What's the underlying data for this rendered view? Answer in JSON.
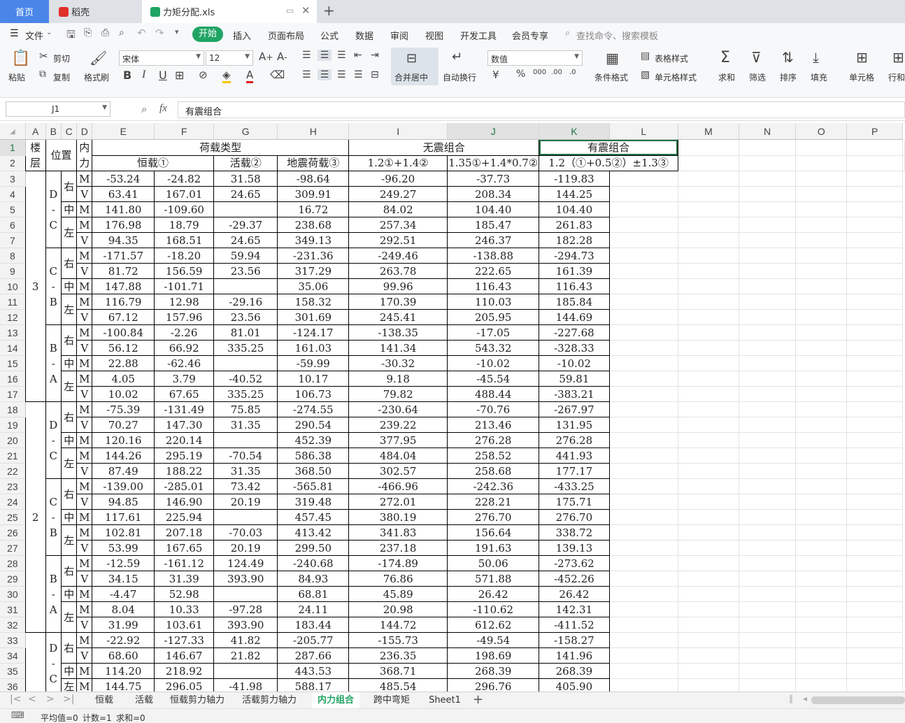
{
  "tabs": {
    "home": "首页",
    "daoke": "稻壳",
    "file": "力矩分配.xls"
  },
  "menu": {
    "file": "文件",
    "items": [
      "开始",
      "插入",
      "页面布局",
      "公式",
      "数据",
      "审阅",
      "视图",
      "开发工具",
      "会员专享"
    ],
    "search": "查找命令、搜索模板"
  },
  "ribbon": {
    "paste": "粘贴",
    "cut": "剪切",
    "copy": "复制",
    "format_painter": "格式刷",
    "font": "宋体",
    "size": "12",
    "merge": "合并居中",
    "wrap": "自动换行",
    "numfmt": "数值",
    "cond": "条件格式",
    "table_style": "表格样式",
    "cell_style": "单元格样式",
    "sum": "求和",
    "filter": "筛选",
    "sort": "排序",
    "fill": "填充",
    "cell": "单元格",
    "rowcol": "行和"
  },
  "formula": {
    "cellref": "J1",
    "fx": "fx",
    "value": "有震组合"
  },
  "grid": {
    "col_headers": [
      "A",
      "B",
      "C",
      "D",
      "E",
      "F",
      "G",
      "H",
      "I",
      "J",
      "K",
      "L",
      "M",
      "N",
      "O",
      "P"
    ],
    "row_numbers": [
      "1",
      "2",
      "3",
      "4",
      "5",
      "6",
      "7",
      "8",
      "9",
      "10",
      "11",
      "12",
      "13",
      "14",
      "15",
      "16",
      "17",
      "18",
      "19",
      "20",
      "21",
      "22",
      "23",
      "24",
      "25",
      "26",
      "27",
      "28",
      "29",
      "30",
      "31",
      "32",
      "33",
      "34",
      "35",
      "36"
    ],
    "head1": {
      "a": "楼层",
      "b": "位置",
      "d": "内力",
      "load": "荷载类型",
      "nonseis": "无震组合",
      "seis": "有震组合"
    },
    "head2": {
      "e": "恒载①",
      "f": "活载②",
      "g": "地震荷载③",
      "h": "1.2①+1.4②",
      "i": "1.35①+1.4*0.7②",
      "jk": "1.2（①+0.5②）±1.3③"
    },
    "floors": [
      "3",
      "2"
    ],
    "spans": [
      "D",
      "-",
      "C",
      "C",
      "-",
      "B",
      "B",
      "-",
      "A"
    ],
    "pos": [
      "右",
      "中",
      "左"
    ],
    "rows": [
      [
        "M",
        "-53.24",
        "-24.82",
        "31.58",
        "-98.64",
        "-96.20",
        "-37.73",
        "-119.83"
      ],
      [
        "V",
        "63.41",
        "167.01",
        "24.65",
        "309.91",
        "249.27",
        "208.34",
        "144.25"
      ],
      [
        "M",
        "141.80",
        "-109.60",
        "",
        "16.72",
        "84.02",
        "104.40",
        "104.40"
      ],
      [
        "M",
        "176.98",
        "18.79",
        "-29.37",
        "238.68",
        "257.34",
        "185.47",
        "261.83"
      ],
      [
        "V",
        "94.35",
        "168.51",
        "24.65",
        "349.13",
        "292.51",
        "246.37",
        "182.28"
      ],
      [
        "M",
        "-171.57",
        "-18.20",
        "59.94",
        "-231.36",
        "-249.46",
        "-138.88",
        "-294.73"
      ],
      [
        "V",
        "81.72",
        "156.59",
        "23.56",
        "317.29",
        "263.78",
        "222.65",
        "161.39"
      ],
      [
        "M",
        "147.88",
        "-101.71",
        "",
        "35.06",
        "99.96",
        "116.43",
        "116.43"
      ],
      [
        "M",
        "116.79",
        "12.98",
        "-29.16",
        "158.32",
        "170.39",
        "110.03",
        "185.84"
      ],
      [
        "V",
        "67.12",
        "157.96",
        "23.56",
        "301.69",
        "245.41",
        "205.95",
        "144.69"
      ],
      [
        "M",
        "-100.84",
        "-2.26",
        "81.01",
        "-124.17",
        "-138.35",
        "-17.05",
        "-227.68"
      ],
      [
        "V",
        "56.12",
        "66.92",
        "335.25",
        "161.03",
        "141.34",
        "543.32",
        "-328.33"
      ],
      [
        "M",
        "22.88",
        "-62.46",
        "",
        "-59.99",
        "-30.32",
        "-10.02",
        "-10.02"
      ],
      [
        "M",
        "4.05",
        "3.79",
        "-40.52",
        "10.17",
        "9.18",
        "-45.54",
        "59.81"
      ],
      [
        "V",
        "10.02",
        "67.65",
        "335.25",
        "106.73",
        "79.82",
        "488.44",
        "-383.21"
      ],
      [
        "M",
        "-75.39",
        "-131.49",
        "75.85",
        "-274.55",
        "-230.64",
        "-70.76",
        "-267.97"
      ],
      [
        "V",
        "70.27",
        "147.30",
        "31.35",
        "290.54",
        "239.22",
        "213.46",
        "131.95"
      ],
      [
        "M",
        "120.16",
        "220.14",
        "",
        "452.39",
        "377.95",
        "276.28",
        "276.28"
      ],
      [
        "M",
        "144.26",
        "295.19",
        "-70.54",
        "586.38",
        "484.04",
        "258.52",
        "441.93"
      ],
      [
        "V",
        "87.49",
        "188.22",
        "31.35",
        "368.50",
        "302.57",
        "258.68",
        "177.17"
      ],
      [
        "M",
        "-139.00",
        "-285.01",
        "73.42",
        "-565.81",
        "-466.96",
        "-242.36",
        "-433.25"
      ],
      [
        "V",
        "94.85",
        "146.90",
        "20.19",
        "319.48",
        "272.01",
        "228.21",
        "175.71"
      ],
      [
        "M",
        "117.61",
        "225.94",
        "",
        "457.45",
        "380.19",
        "276.70",
        "276.70"
      ],
      [
        "M",
        "102.81",
        "207.18",
        "-70.03",
        "413.42",
        "341.83",
        "156.64",
        "338.72"
      ],
      [
        "V",
        "53.99",
        "167.65",
        "20.19",
        "299.50",
        "237.18",
        "191.63",
        "139.13"
      ],
      [
        "M",
        "-12.59",
        "-161.12",
        "124.49",
        "-240.68",
        "-174.89",
        "50.06",
        "-273.62"
      ],
      [
        "V",
        "34.15",
        "31.39",
        "393.90",
        "84.93",
        "76.86",
        "571.88",
        "-452.26"
      ],
      [
        "M",
        "-4.47",
        "52.98",
        "",
        "68.81",
        "45.89",
        "26.42",
        "26.42"
      ],
      [
        "M",
        "8.04",
        "10.33",
        "-97.28",
        "24.11",
        "20.98",
        "-110.62",
        "142.31"
      ],
      [
        "V",
        "31.99",
        "103.61",
        "393.90",
        "183.44",
        "144.72",
        "612.62",
        "-411.52"
      ],
      [
        "M",
        "-22.92",
        "-127.33",
        "41.82",
        "-205.77",
        "-155.73",
        "-49.54",
        "-158.27"
      ],
      [
        "V",
        "68.60",
        "146.67",
        "21.82",
        "287.66",
        "236.35",
        "198.69",
        "141.96"
      ],
      [
        "M",
        "114.20",
        "218.92",
        "",
        "443.53",
        "368.71",
        "268.39",
        "268.39"
      ],
      [
        "M",
        "144.75",
        "296.05",
        "-41.98",
        "588.17",
        "485.54",
        "296.76",
        "405.90"
      ]
    ]
  },
  "sheets": {
    "items": [
      "恒载",
      "活载",
      "恒载剪力轴力",
      "活载剪力轴力",
      "内力组合",
      "跨中弯矩",
      "Sheet1"
    ],
    "active": 4
  },
  "status": {
    "avg": "平均值=0",
    "count": "计数=1",
    "sum": "求和=0"
  }
}
